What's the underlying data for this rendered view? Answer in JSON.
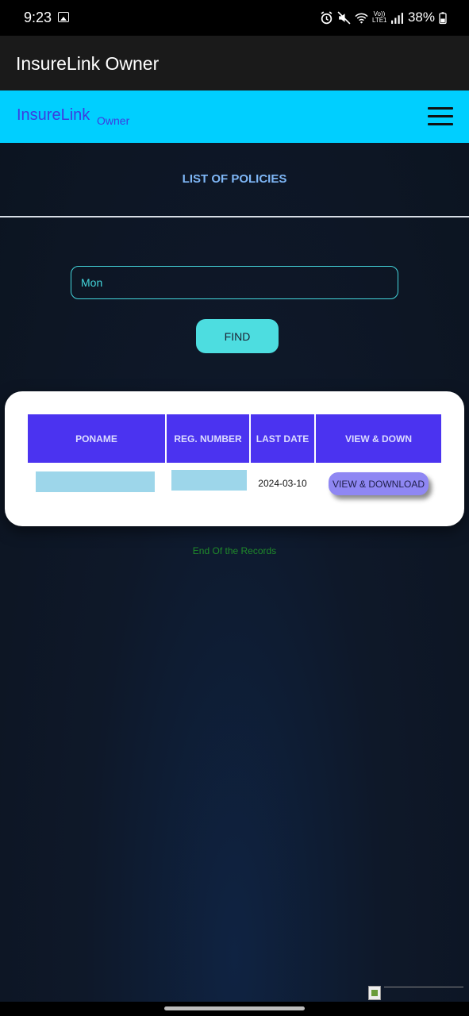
{
  "status_bar": {
    "time": "9:23",
    "network_label": "Vo)) LTE1",
    "battery": "38%",
    "icons": [
      "image-icon",
      "alarm-icon",
      "mute-icon",
      "wifi-icon",
      "signal-icon",
      "battery-icon"
    ]
  },
  "app_bar": {
    "title": "InsureLink Owner"
  },
  "site_nav": {
    "brand": "InsureLink",
    "brand_sub": "Owner",
    "brand_color": "#3d3ce0",
    "nav_color": "#00cfff"
  },
  "page": {
    "title": "LIST OF POLICIES"
  },
  "search": {
    "value": "Mon",
    "button_label": "FIND",
    "accent": "#44d6dc"
  },
  "table": {
    "header_color": "#4b33f0",
    "columns": [
      "PONAME",
      "REG. NUMBER",
      "LAST DATE",
      "VIEW & DOWN"
    ],
    "rows": [
      {
        "poname": "",
        "reg_number": "",
        "last_date": "2024-03-10",
        "action_label": "VIEW & DOWNLOAD"
      }
    ]
  },
  "footer": {
    "end_text": "End Of the Records",
    "end_color": "#1f8a2a"
  }
}
